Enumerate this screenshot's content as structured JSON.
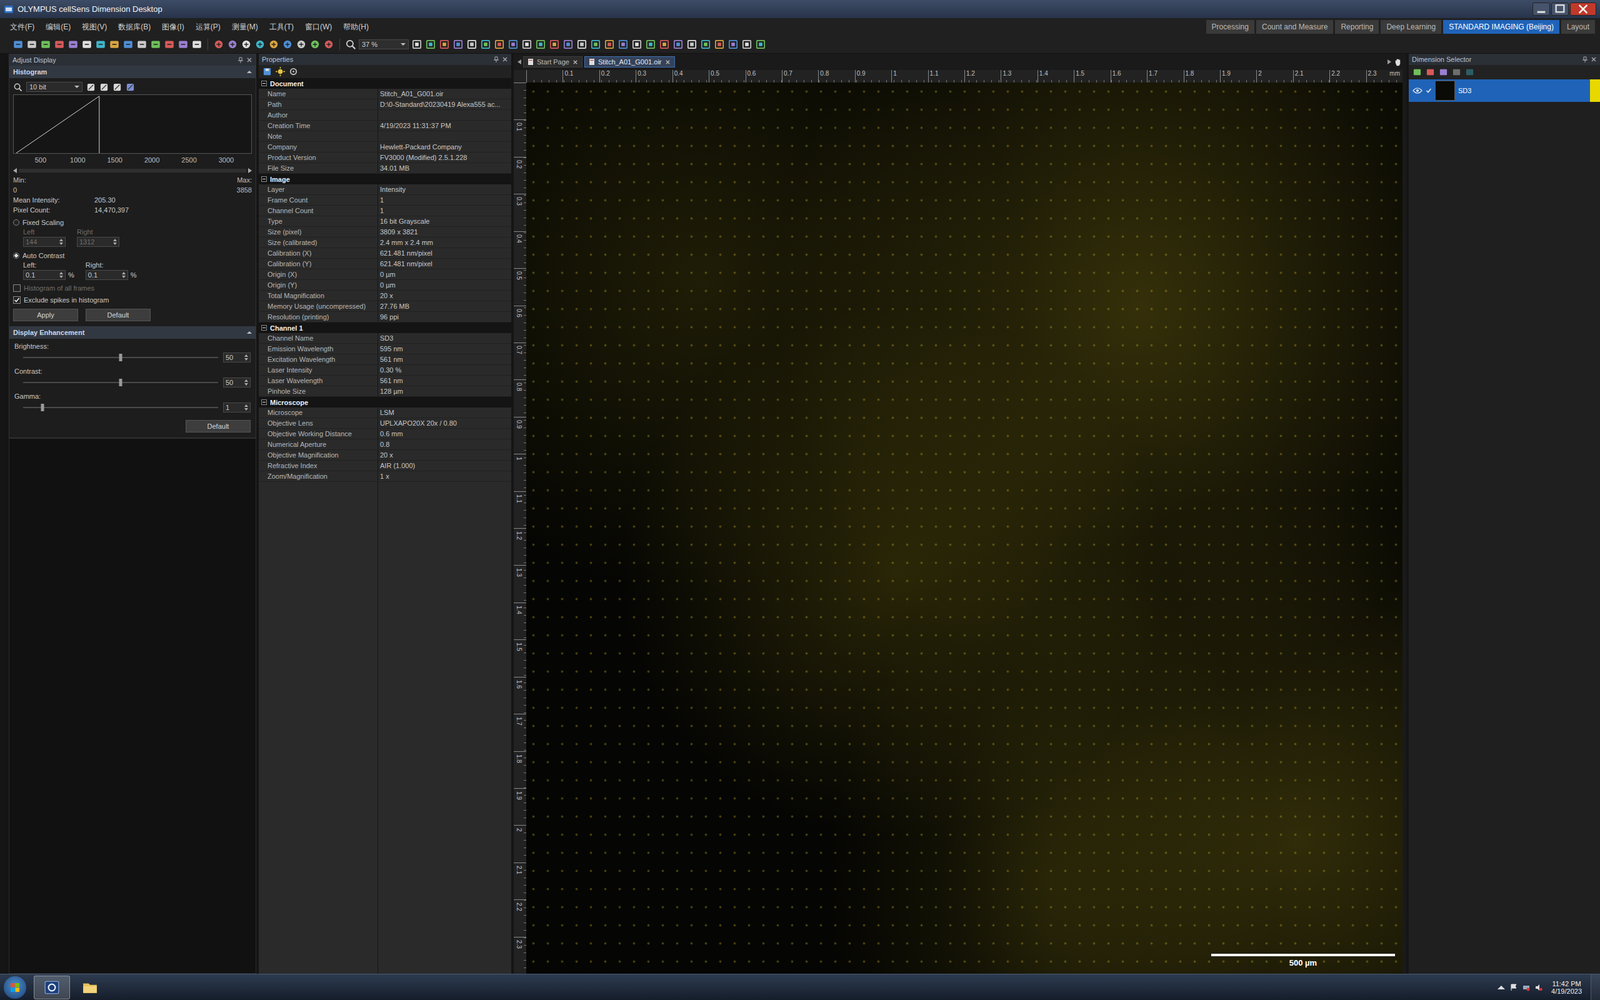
{
  "window": {
    "title": "OLYMPUS cellSens Dimension Desktop"
  },
  "menus": [
    "文件(F)",
    "编辑(E)",
    "视图(V)",
    "数据库(B)",
    "图像(I)",
    "运算(P)",
    "测量(M)",
    "工具(T)",
    "窗口(W)",
    "帮助(H)"
  ],
  "layouts": [
    {
      "label": "Processing",
      "selected": false
    },
    {
      "label": "Count and Measure",
      "selected": false
    },
    {
      "label": "Reporting",
      "selected": false
    },
    {
      "label": "Deep Learning",
      "selected": false
    },
    {
      "label": "STANDARD IMAGING (Beijing)",
      "selected": true
    },
    {
      "label": "Layout",
      "selected": false
    }
  ],
  "toolbar": {
    "zoom": "37 %"
  },
  "adjust_display": {
    "title": "Adjust Display",
    "histogram": {
      "title": "Histogram",
      "bit_depth": "10 bit",
      "ticks": [
        "500",
        "1000",
        "1500",
        "2000",
        "2500",
        "3000"
      ],
      "curve_start": 0.01,
      "curve_end": 0.36,
      "min_label": "Min:",
      "max_label": "Max:",
      "min": "0",
      "max": "3858",
      "stats": [
        {
          "label": "Mean Intensity:",
          "value": "205.30"
        },
        {
          "label": "Pixel Count:",
          "value": "14,470,397"
        }
      ],
      "modes": [
        {
          "label": "Fixed Scaling",
          "selected": false,
          "fields": [
            {
              "label": "Left",
              "value": "144",
              "unit": "",
              "disabled": true
            },
            {
              "label": "Right",
              "value": "1312",
              "unit": "",
              "disabled": true
            }
          ]
        },
        {
          "label": "Auto Contrast",
          "selected": true,
          "fields": [
            {
              "label": "Left:",
              "value": "0.1",
              "unit": "%",
              "disabled": false
            },
            {
              "label": "Right:",
              "value": "0.1",
              "unit": "%",
              "disabled": false
            }
          ]
        }
      ],
      "options": [
        {
          "label": "Histogram of all frames",
          "checked": false,
          "disabled": true
        },
        {
          "label": "Exclude spikes in histogram",
          "checked": true,
          "disabled": false
        }
      ],
      "buttons": [
        "Apply",
        "Default"
      ]
    },
    "enhancement": {
      "title": "Display Enhancement",
      "sliders": [
        {
          "label": "Brightness:",
          "value": "50",
          "level": 0.5
        },
        {
          "label": "Contrast:",
          "value": "50",
          "level": 0.5
        },
        {
          "label": "Gamma:",
          "value": "1",
          "level": 0.1
        }
      ],
      "button": "Default"
    }
  },
  "properties": {
    "title": "Properties",
    "groups": [
      {
        "title": "Document",
        "expanded": true,
        "rows": [
          {
            "label": "Name",
            "value": "Stitch_A01_G001.oir"
          },
          {
            "label": "Path",
            "value": "D:\\0-Standard\\20230419 Alexa555 ac..."
          },
          {
            "label": "Author",
            "value": ""
          },
          {
            "label": "Creation Time",
            "value": "4/19/2023 11:31:37 PM"
          },
          {
            "label": "Note",
            "value": ""
          },
          {
            "label": "Company",
            "value": "Hewlett-Packard Company"
          },
          {
            "label": "Product Version",
            "value": "FV3000 (Modified) 2.5.1.228"
          },
          {
            "label": "File Size",
            "value": "34.01 MB"
          }
        ]
      },
      {
        "title": "Image",
        "expanded": true,
        "rows": [
          {
            "label": "Layer",
            "value": "Intensity"
          },
          {
            "label": "Frame Count",
            "value": "1"
          },
          {
            "label": "Channel Count",
            "value": "1"
          },
          {
            "label": "Type",
            "value": "16 bit Grayscale"
          },
          {
            "label": "Size (pixel)",
            "value": "3809 x 3821"
          },
          {
            "label": "Size (calibrated)",
            "value": "2.4 mm x 2.4 mm"
          },
          {
            "label": "Calibration (X)",
            "value": "621.481 nm/pixel"
          },
          {
            "label": "Calibration (Y)",
            "value": "621.481 nm/pixel"
          },
          {
            "label": "Origin (X)",
            "value": "0 µm"
          },
          {
            "label": "Origin (Y)",
            "value": "0 µm"
          },
          {
            "label": "Total Magnification",
            "value": "20 x"
          },
          {
            "label": "Memory Usage (uncompressed)",
            "value": "27.76 MB"
          },
          {
            "label": "Resolution (printing)",
            "value": "96 ppi"
          }
        ]
      },
      {
        "title": "Channel 1",
        "expanded": true,
        "rows": [
          {
            "label": "Channel Name",
            "value": "SD3"
          },
          {
            "label": "Emission Wavelength",
            "value": "595 nm"
          },
          {
            "label": "Excitation Wavelength",
            "value": "561 nm"
          },
          {
            "label": "Laser Intensity",
            "value": "0.30 %"
          },
          {
            "label": "Laser Wavelength",
            "value": "561 nm"
          },
          {
            "label": "Pinhole Size",
            "value": "128 µm"
          }
        ]
      },
      {
        "title": "Microscope",
        "expanded": true,
        "rows": [
          {
            "label": "Microscope",
            "value": "LSM"
          },
          {
            "label": "Objective Lens",
            "value": "UPLXAPO20X 20x / 0.80"
          },
          {
            "label": "Objective Working Distance",
            "value": "0.6 mm"
          },
          {
            "label": "Numerical Aperture",
            "value": "0.8"
          },
          {
            "label": "Objective Magnification",
            "value": "20 x"
          },
          {
            "label": "Refractive Index",
            "value": "AIR (1.000)"
          },
          {
            "label": "Zoom/Magnification",
            "value": "1 x"
          }
        ]
      }
    ]
  },
  "viewer": {
    "tabs": [
      {
        "label": "Start Page",
        "selected": false
      },
      {
        "label": "Stitch_A01_G001.oir",
        "selected": true
      }
    ],
    "ruler_x": [
      "0.1",
      "0.2",
      "0.3",
      "0.4",
      "0.5",
      "0.6",
      "0.7",
      "0.8",
      "0.9",
      "1",
      "1.1",
      "1.2",
      "1.3",
      "1.4",
      "1.5",
      "1.6",
      "1.7",
      "1.8",
      "1.9",
      "2",
      "2.1",
      "2.2",
      "2.3"
    ],
    "ruler_unit": "mm",
    "ruler_y": [
      "0.1",
      "0.2",
      "0.3",
      "0.4",
      "0.5",
      "0.6",
      "0.7",
      "0.8",
      "0.9",
      "1",
      "1.1",
      "1.2",
      "1.3",
      "1.4",
      "1.5",
      "1.6",
      "1.7",
      "1.8",
      "1.9",
      "2",
      "2.1",
      "2.2",
      "2.3"
    ],
    "scale_bar": "500 µm"
  },
  "dimension_selector": {
    "title": "Dimension Selector",
    "channels": [
      {
        "label": "SD3",
        "selected": true,
        "visible": true,
        "checked": true,
        "color": "#e8d800"
      }
    ]
  },
  "taskbar": {
    "apps": [
      {
        "kind": "cellsens",
        "selected": true
      },
      {
        "kind": "folder",
        "selected": false
      }
    ],
    "time": "11:42 PM",
    "date": "4/19/2023"
  }
}
